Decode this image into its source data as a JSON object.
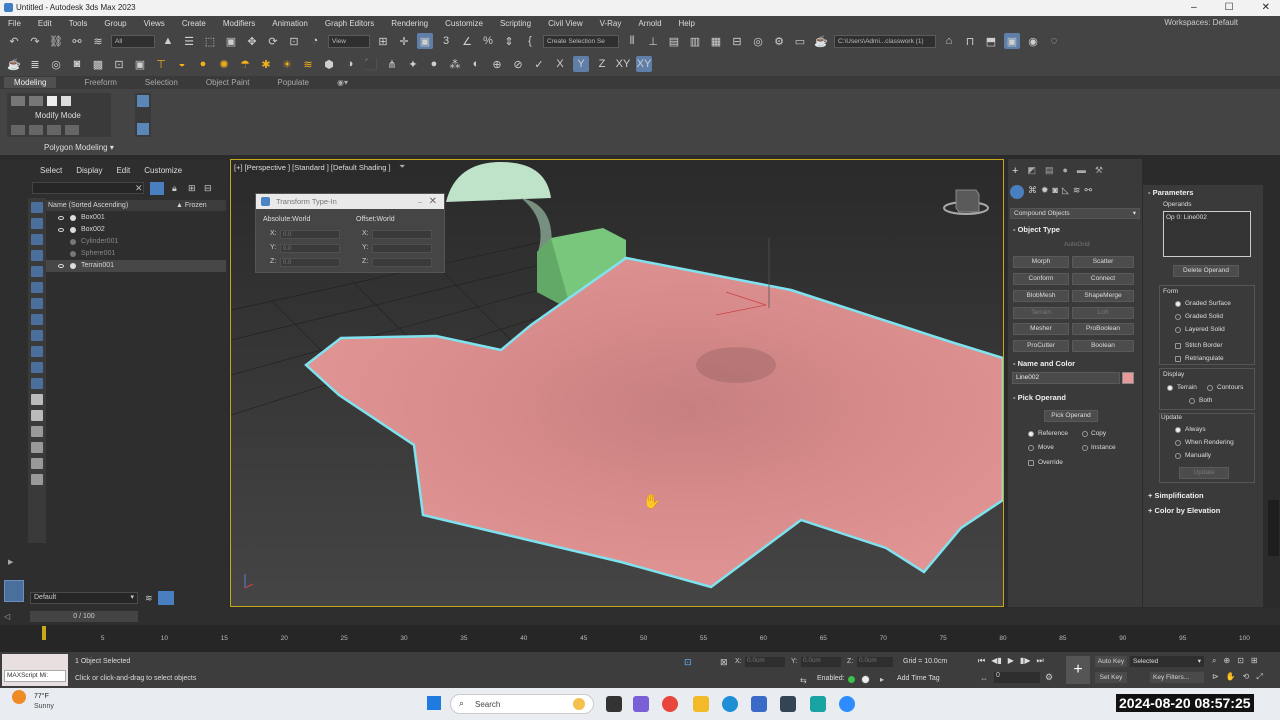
{
  "window": {
    "title": "Untitled - Autodesk 3ds Max 2023",
    "controls": [
      "–",
      "☐",
      "✕"
    ]
  },
  "menu": {
    "items": [
      "File",
      "Edit",
      "Tools",
      "Group",
      "Views",
      "Create",
      "Modifiers",
      "Animation",
      "Graph Editors",
      "Rendering",
      "Customize",
      "Scripting",
      "Civil View",
      "V-Ray",
      "Arnold",
      "Help"
    ],
    "workspaces_label": "Workspaces: Default"
  },
  "toolbar1": {
    "filter": "All",
    "ref_coord": "View",
    "selection_set": "Create Selection Se",
    "path": "C:\\Users\\Admi...classwork (1)"
  },
  "toolbar2": {
    "axes": [
      "X",
      "Y",
      "Z",
      "XY",
      "XY"
    ]
  },
  "ribbon": {
    "tabs": [
      "Modeling",
      "Freeform",
      "Selection",
      "Object Paint",
      "Populate"
    ],
    "modify_mode": "Modify Mode",
    "polygon_modeling": "Polygon Modeling"
  },
  "scene_explorer": {
    "menu": [
      "Select",
      "Display",
      "Edit",
      "Customize"
    ],
    "col_name": "Name (Sorted Ascending)",
    "col_frozen": "▲ Frozen",
    "objects": [
      {
        "name": "Box001",
        "hidden": false
      },
      {
        "name": "Box002",
        "hidden": false
      },
      {
        "name": "Cylinder001",
        "hidden": true
      },
      {
        "name": "Sphere001",
        "hidden": true
      },
      {
        "name": "Terrain001",
        "hidden": false
      }
    ],
    "layer": "Default"
  },
  "viewport": {
    "label": "[+] [Perspective ] [Standard ] [Default Shading ]"
  },
  "transform_dialog": {
    "title": "Transform Type-In",
    "absolute": "Absolute:World",
    "offset": "Offset:World",
    "abs_values": {
      "x": "0.0",
      "y": "0.0",
      "z": "0.0"
    },
    "axis_labels": [
      "X:",
      "Y:",
      "Z:"
    ]
  },
  "command_panel": {
    "category": "Compound Objects",
    "object_type_title": "Object Type",
    "autogrid": "AutoGrid",
    "buttons": [
      {
        "label": "Morph",
        "enabled": true
      },
      {
        "label": "Scatter",
        "enabled": true
      },
      {
        "label": "Conform",
        "enabled": true
      },
      {
        "label": "Connect",
        "enabled": true
      },
      {
        "label": "BlobMesh",
        "enabled": true
      },
      {
        "label": "ShapeMerge",
        "enabled": true
      },
      {
        "label": "Terrain",
        "enabled": false
      },
      {
        "label": "Loft",
        "enabled": false
      },
      {
        "label": "Mesher",
        "enabled": true
      },
      {
        "label": "ProBoolean",
        "enabled": true
      },
      {
        "label": "ProCutter",
        "enabled": true
      },
      {
        "label": "Boolean",
        "enabled": true
      }
    ],
    "name_color_title": "Name and Color",
    "object_name": "Line002",
    "object_color": "#e89a9a",
    "pick_operand_title": "Pick Operand",
    "pick_operand_button": "Pick Operand",
    "pick_options": [
      {
        "label": "Reference",
        "on": true
      },
      {
        "label": "Copy",
        "on": false
      },
      {
        "label": "Move",
        "on": false
      },
      {
        "label": "Instance",
        "on": false
      }
    ],
    "override": "Override"
  },
  "parameters": {
    "title": "Parameters",
    "operands_label": "Operands",
    "operand_item": "Op 0: Line002",
    "delete_operand": "Delete Operand",
    "form_label": "Form",
    "form_options": [
      {
        "label": "Graded Surface",
        "on": true
      },
      {
        "label": "Graded Solid",
        "on": false
      },
      {
        "label": "Layered Solid",
        "on": false
      }
    ],
    "stitch_border": "Stitch Border",
    "retriangulate": "Retriangulate",
    "display_label": "Display",
    "display_options": [
      {
        "label": "Terrain",
        "on": true
      },
      {
        "label": "Contours",
        "on": false
      },
      {
        "label": "Both",
        "on": false
      }
    ],
    "update_label": "Update",
    "update_options": [
      {
        "label": "Always",
        "on": true
      },
      {
        "label": "When Rendering",
        "on": false
      },
      {
        "label": "Manually",
        "on": false
      }
    ],
    "update_button": "Update",
    "simplification": "Simplification",
    "color_by_elevation": "Color by Elevation"
  },
  "timeline": {
    "frame": "0 / 100",
    "ticks": [
      "0",
      "5",
      "10",
      "15",
      "20",
      "25",
      "30",
      "35",
      "40",
      "45",
      "50",
      "55",
      "60",
      "65",
      "70",
      "75",
      "80",
      "85",
      "90",
      "95",
      "100"
    ]
  },
  "status": {
    "script_label": "MAXScript Mi:",
    "selected": "1 Object Selected",
    "prompt": "Click or click-and-drag to select objects",
    "x_label": "X:",
    "x_value": "0.0cm",
    "y_label": "Y:",
    "y_value": "0.0cm",
    "z_label": "Z:",
    "z_value": "0.0cm",
    "grid": "Grid = 10.0cm",
    "enabled": "Enabled:",
    "add_time_tag": "Add Time Tag",
    "auto_key": "Auto Key",
    "set_key": "Set Key",
    "key_mode": "Selected",
    "key_filters": "Key Filters...",
    "frame_field": "0"
  },
  "taskbar": {
    "weather_temp": "77°F",
    "weather_desc": "Sunny",
    "search": "Search",
    "datetime": "2024-08-20 08:57:25"
  }
}
